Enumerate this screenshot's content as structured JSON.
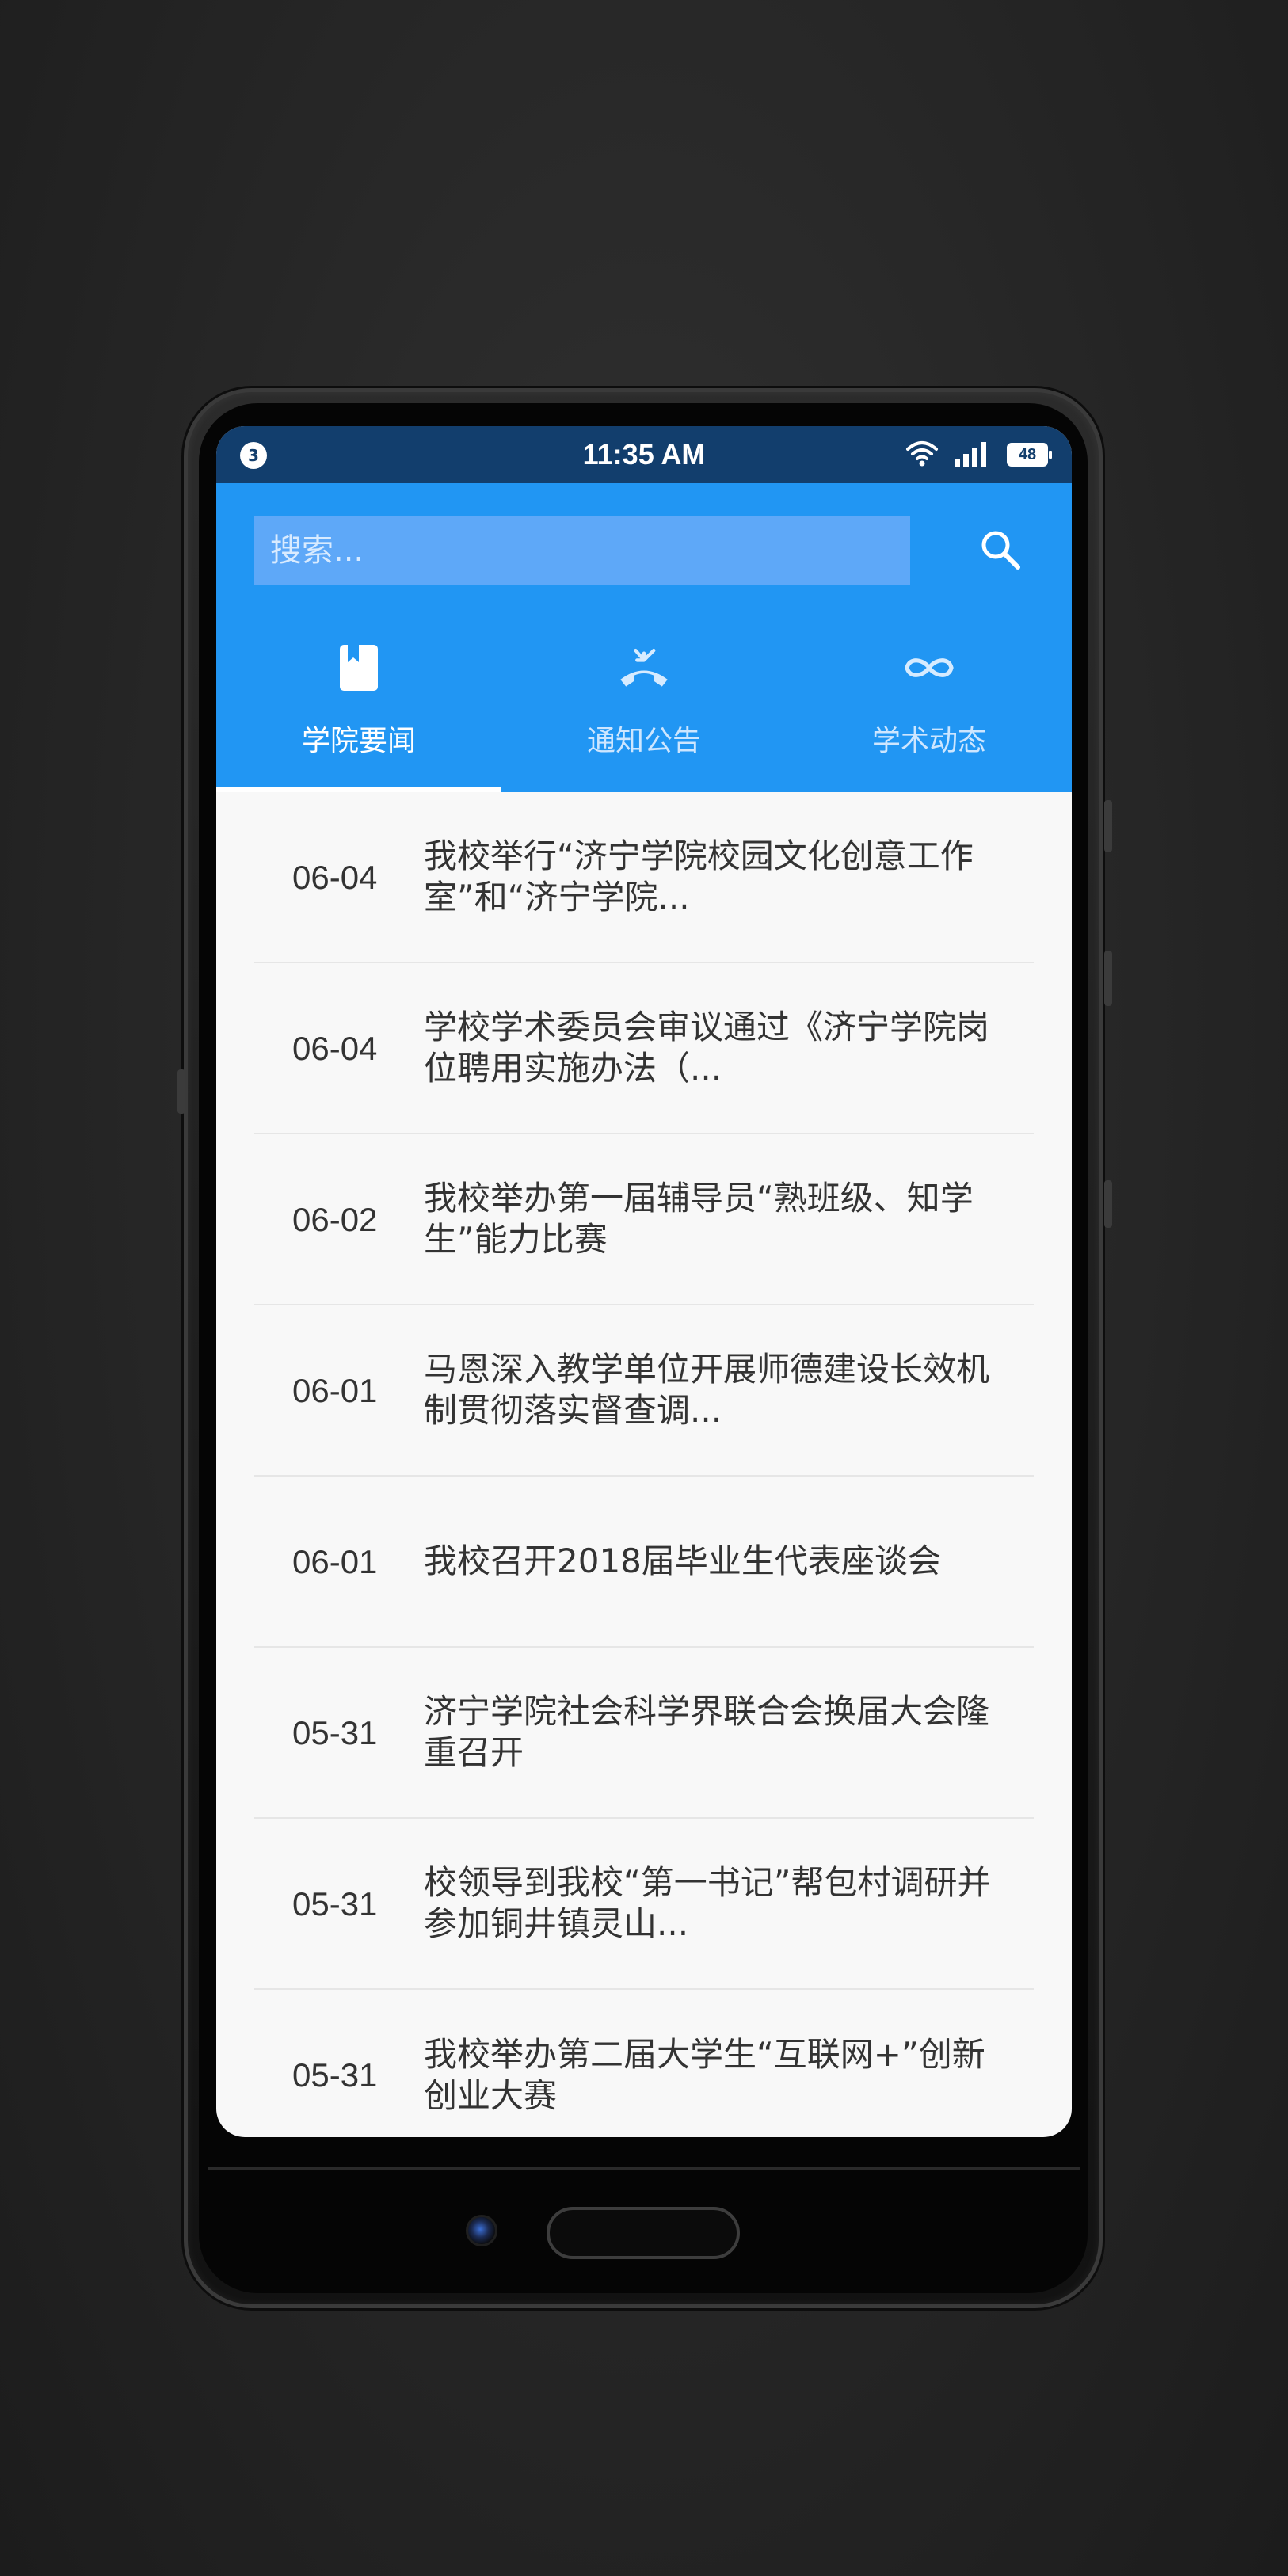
{
  "status_bar": {
    "notification_count": "3",
    "time": "11:35 AM",
    "battery": "48",
    "icons": [
      "wifi-icon",
      "signal-icon",
      "battery-icon"
    ]
  },
  "search": {
    "placeholder": "搜索...",
    "icon": "search-icon"
  },
  "tabs": [
    {
      "label": "学院要闻",
      "icon": "book-icon",
      "active": true
    },
    {
      "label": "通知公告",
      "icon": "phone-incoming-icon",
      "active": false
    },
    {
      "label": "学术动态",
      "icon": "infinity-icon",
      "active": false
    }
  ],
  "news": [
    {
      "date": "06-04",
      "title": "我校举行“济宁学院校园文化创意工作室”和“济宁学院..."
    },
    {
      "date": "06-04",
      "title": "学校学术委员会审议通过《济宁学院岗位聘用实施办法（..."
    },
    {
      "date": "06-02",
      "title": "我校举办第一届辅导员“熟班级、知学生”能力比赛"
    },
    {
      "date": "06-01",
      "title": "马恩深入教学单位开展师德建设长效机制贯彻落实督查调..."
    },
    {
      "date": "06-01",
      "title": "我校召开2018届毕业生代表座谈会"
    },
    {
      "date": "05-31",
      "title": "济宁学院社会科学界联合会换届大会隆重召开"
    },
    {
      "date": "05-31",
      "title": "校领导到我校“第一书记”帮包村调研并参加铜井镇灵山..."
    },
    {
      "date": "05-31",
      "title": "我校举办第二届大学生“互联网+”创新创业大赛"
    }
  ],
  "colors": {
    "header": "#2196f3",
    "status_bar": "#123e6d",
    "search_field": "#5ea8f8",
    "list_background": "#f8f8f8"
  }
}
